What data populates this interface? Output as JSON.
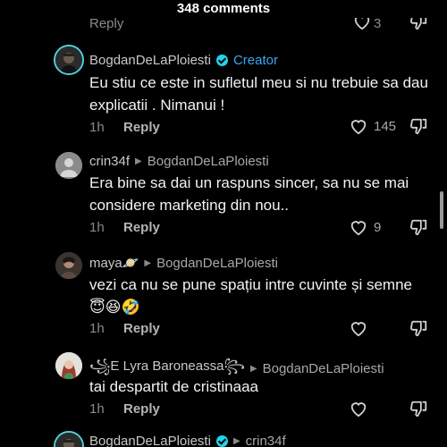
{
  "header": {
    "comment_count": "348 comments"
  },
  "partial_top": {
    "reply_label": "Reply",
    "likes": "3"
  },
  "comments": [
    {
      "author": "BogdanDeLaPloiesti",
      "creator_tag": "Creator",
      "text": "Eu stiu ce este in sufletul meu si nu trebuie sa dau explicatii . Nimanui !",
      "time": "1h",
      "reply_label": "Reply",
      "likes": "145"
    },
    {
      "author": "crin34f",
      "reply_to": "BogdanDeLaPloiesti",
      "text": "Era bine sa dai un raspuns sincer, sa nu se mai considere marketing din nou..",
      "time": "1h",
      "reply_label": "Reply",
      "likes": "9"
    },
    {
      "author": "maya🪐",
      "reply_to": "BogdanDeLaPloiesti",
      "text": "vezi ca nu se pune spațiu intre cuvinte și semne",
      "emoji": "😇😆🤣",
      "time": "1h",
      "reply_label": "Reply",
      "likes": ""
    },
    {
      "author": "꧁E Lyra Baroneassa꧂",
      "reply_to": "BogdanDeLaPloiesti",
      "text": "tai despartit de cristinaaa",
      "time": "1h",
      "reply_label": "Reply",
      "likes": ""
    },
    {
      "author": "BogdanDeLaPloiesti",
      "reply_to": "crin34f"
    }
  ],
  "colors": {
    "creator_ring": "#4fd1d9",
    "creator_tag": "#3aa6f0",
    "verified": "#20d5ec"
  }
}
